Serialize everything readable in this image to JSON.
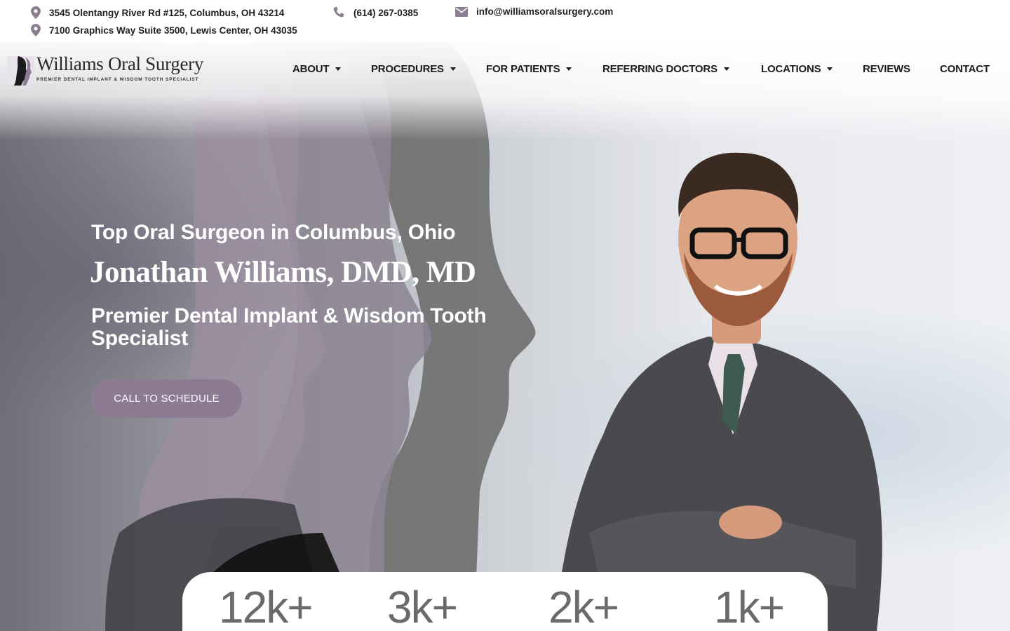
{
  "contact": {
    "address1": "3545 Olentangy River Rd #125, Columbus, OH 43214",
    "phone": "(614) 267-0385",
    "email": "info@williamsoralsurgery.com",
    "address2": "7100 Graphics Way Suite 3500, Lewis Center, OH 43035",
    "icons": [
      "map-pin-icon",
      "phone-icon",
      "mail-icon",
      "map-pin-icon"
    ]
  },
  "logo": {
    "name": "Williams Oral Surgery",
    "tagline": "PREMIER DENTAL IMPLANT & WISDOM TOOTH SPECIALIST"
  },
  "nav": {
    "items": [
      {
        "label": "ABOUT",
        "dropdown": true
      },
      {
        "label": "PROCEDURES",
        "dropdown": true
      },
      {
        "label": "FOR PATIENTS",
        "dropdown": true
      },
      {
        "label": "REFERRING DOCTORS",
        "dropdown": true
      },
      {
        "label": "LOCATIONS",
        "dropdown": true
      },
      {
        "label": "REVIEWS",
        "dropdown": false
      },
      {
        "label": "CONTACT",
        "dropdown": false
      }
    ]
  },
  "hero": {
    "eyebrow": "Top Oral Surgeon in Columbus, Ohio",
    "headline": "Jonathan Williams, DMD, MD",
    "subhead": "Premier Dental Implant & Wisdom Tooth Specialist",
    "cta_label": "CALL TO SCHEDULE"
  },
  "stats": [
    "12k+",
    "3k+",
    "2k+",
    "1k+"
  ],
  "colors": {
    "accent": "#8d7b93",
    "icon": "#8a7f90",
    "text_dark": "#1c1c1c",
    "stat_text": "#6a6a6a"
  }
}
